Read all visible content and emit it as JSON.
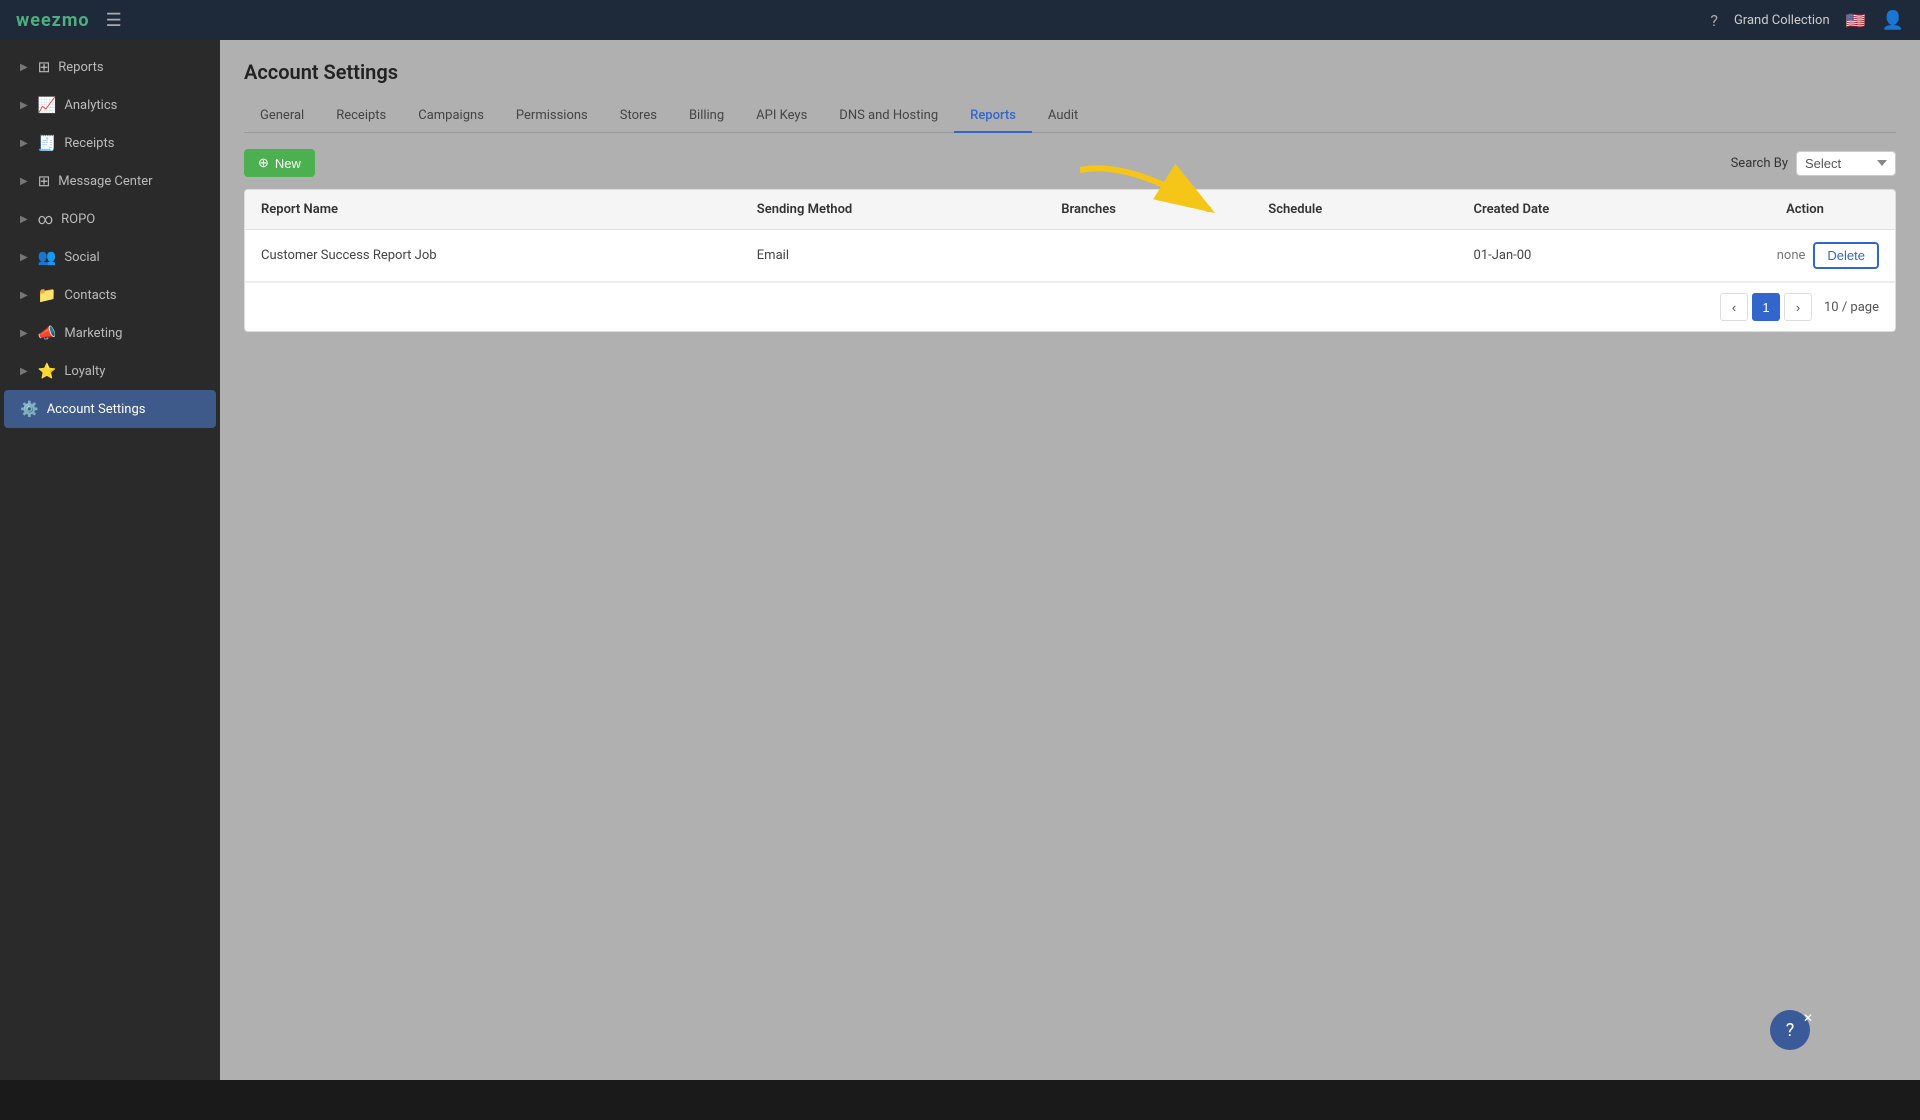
{
  "topnav": {
    "logo": "weezmo",
    "hamburger_icon": "☰",
    "org_name": "Grand Collection",
    "flag": "🇺🇸",
    "help_icon": "?",
    "user_icon": "👤"
  },
  "sidebar": {
    "items": [
      {
        "id": "reports",
        "label": "Reports",
        "icon": "📊",
        "active": false
      },
      {
        "id": "analytics",
        "label": "Analytics",
        "icon": "📈",
        "active": false
      },
      {
        "id": "receipts",
        "label": "Receipts",
        "icon": "🧾",
        "active": false
      },
      {
        "id": "message-center",
        "label": "Message Center",
        "icon": "✉️",
        "active": false
      },
      {
        "id": "ropo",
        "label": "ROPO",
        "icon": "🔗",
        "active": false
      },
      {
        "id": "social",
        "label": "Social",
        "icon": "👥",
        "active": false
      },
      {
        "id": "contacts",
        "label": "Contacts",
        "icon": "📁",
        "active": false
      },
      {
        "id": "marketing",
        "label": "Marketing",
        "icon": "📣",
        "active": false
      },
      {
        "id": "loyalty",
        "label": "Loyalty",
        "icon": "⭐",
        "active": false
      },
      {
        "id": "account-settings",
        "label": "Account Settings",
        "icon": "⚙️",
        "active": true
      }
    ]
  },
  "page": {
    "title": "Account Settings",
    "tabs": [
      {
        "id": "general",
        "label": "General",
        "active": false
      },
      {
        "id": "receipts",
        "label": "Receipts",
        "active": false
      },
      {
        "id": "campaigns",
        "label": "Campaigns",
        "active": false
      },
      {
        "id": "permissions",
        "label": "Permissions",
        "active": false
      },
      {
        "id": "stores",
        "label": "Stores",
        "active": false
      },
      {
        "id": "billing",
        "label": "Billing",
        "active": false
      },
      {
        "id": "api-keys",
        "label": "API Keys",
        "active": false
      },
      {
        "id": "dns-hosting",
        "label": "DNS and Hosting",
        "active": false
      },
      {
        "id": "reports",
        "label": "Reports",
        "active": true
      },
      {
        "id": "audit",
        "label": "Audit",
        "active": false
      }
    ],
    "toolbar": {
      "new_button": "New",
      "search_by_label": "Search By",
      "search_placeholder": "Select"
    },
    "table": {
      "columns": [
        {
          "id": "report-name",
          "label": "Report Name"
        },
        {
          "id": "sending-method",
          "label": "Sending Method"
        },
        {
          "id": "branches",
          "label": "Branches"
        },
        {
          "id": "schedule",
          "label": "Schedule"
        },
        {
          "id": "created-date",
          "label": "Created Date"
        },
        {
          "id": "action",
          "label": "Action"
        }
      ],
      "rows": [
        {
          "report_name": "Customer Success Report Job",
          "sending_method": "Email",
          "branches": "",
          "schedule": "",
          "created_date": "01-Jan-00",
          "action_none": "none",
          "delete_label": "Delete"
        }
      ]
    },
    "pagination": {
      "prev": "‹",
      "current_page": "1",
      "next": "›",
      "per_page": "10 / page"
    }
  },
  "help_fab": {
    "icon": "?",
    "close": "✕"
  }
}
